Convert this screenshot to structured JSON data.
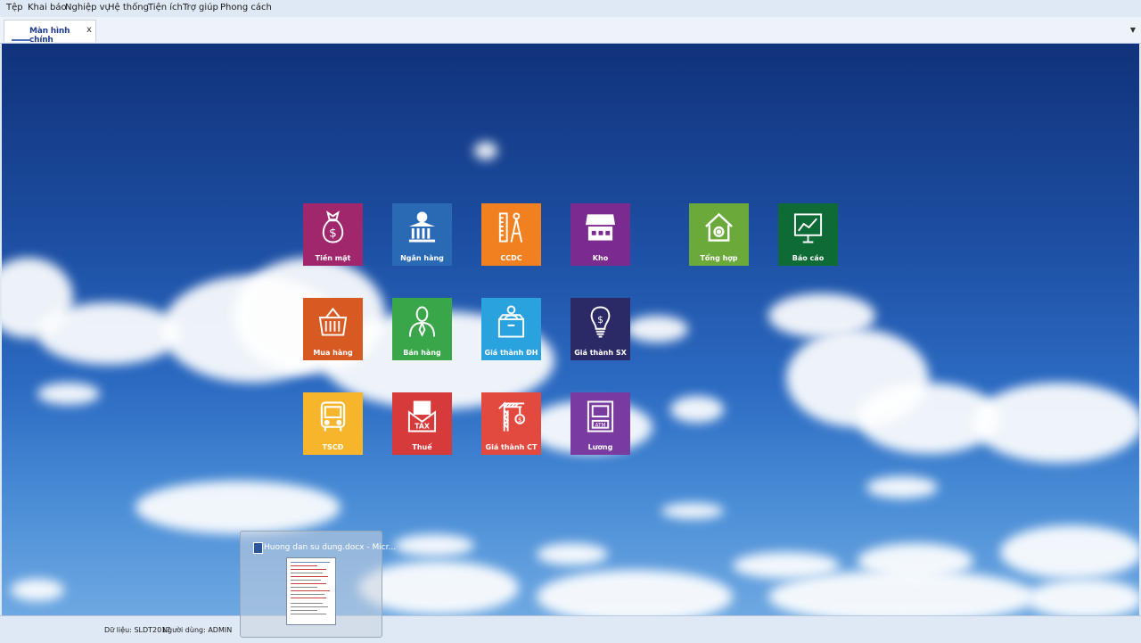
{
  "menu": [
    "Tệp",
    "Khai báo",
    "Nghiệp vụ",
    "Hệ thống",
    "Tiện ích",
    "Trợ giúp",
    "Phong cách"
  ],
  "tab": {
    "label": "Màn hình chính",
    "close": "x",
    "dropdown": "▼"
  },
  "tiles": [
    {
      "label": "Tiền mặt",
      "icon": "money-bag-icon",
      "color": "#a0276b"
    },
    {
      "label": "Ngân hàng",
      "icon": "bank-icon",
      "color": "#2a6ab5"
    },
    {
      "label": "CCDC",
      "icon": "tools-icon",
      "color": "#f08020"
    },
    {
      "label": "Kho",
      "icon": "store-icon",
      "color": "#7b2a8f"
    },
    {
      "label": "Tổng hợp",
      "icon": "house-gear-icon",
      "color": "#6aa93a"
    },
    {
      "label": "Báo cáo",
      "icon": "chart-board-icon",
      "color": "#0f6b35"
    },
    {
      "label": "Mua hàng",
      "icon": "basket-icon",
      "color": "#d65a22"
    },
    {
      "label": "Bán hàng",
      "icon": "salesman-icon",
      "color": "#3aa64a"
    },
    {
      "label": "Giá thành ĐH",
      "icon": "box-person-icon",
      "color": "#2aa2de"
    },
    {
      "label": "Giá thành SX",
      "icon": "lightbulb-icon",
      "color": "#2c2a66"
    },
    {
      "label": "TSCĐ",
      "icon": "vehicle-icon",
      "color": "#f6b52a"
    },
    {
      "label": "Thuế",
      "icon": "tax-envelope-icon",
      "color": "#d63a3a"
    },
    {
      "label": "Giá thành CT",
      "icon": "crane-icon",
      "color": "#e24a3f"
    },
    {
      "label": "Lương",
      "icon": "atm-icon",
      "color": "#7a3ba0"
    }
  ],
  "status": {
    "data": "Dữ liệu: SLDT2017",
    "user": "Người dùng: ADMIN"
  },
  "taskbar_preview": {
    "title": "Huong dan su dung.docx - Micr..."
  }
}
